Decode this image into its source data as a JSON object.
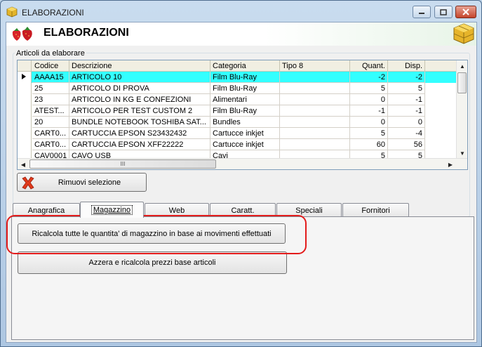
{
  "window": {
    "title": "ELABORAZIONI"
  },
  "banner": {
    "title": "ELABORAZIONI"
  },
  "group": {
    "label": "Articoli da elaborare"
  },
  "grid": {
    "columns": [
      "Codice",
      "Descrizione",
      "Categoria",
      "Tipo 8",
      "Quant.",
      "Disp."
    ],
    "rows": [
      {
        "codice": "AAAA15",
        "descrizione": "ARTICOLO 10",
        "categoria": "Film Blu-Ray",
        "tipo": "",
        "quant": "-2",
        "disp": "-2",
        "selected": true
      },
      {
        "codice": "25",
        "descrizione": "ARTICOLO DI PROVA",
        "categoria": "Film Blu-Ray",
        "tipo": "",
        "quant": "5",
        "disp": "5"
      },
      {
        "codice": "23",
        "descrizione": "ARTICOLO IN KG E CONFEZIONI",
        "categoria": "Alimentari",
        "tipo": "",
        "quant": "0",
        "disp": "-1"
      },
      {
        "codice": "ATEST...",
        "descrizione": "ARTICOLO PER TEST CUSTOM 2",
        "categoria": "Film Blu-Ray",
        "tipo": "",
        "quant": "-1",
        "disp": "-1"
      },
      {
        "codice": "20",
        "descrizione": "BUNDLE NOTEBOOK TOSHIBA SAT...",
        "categoria": "Bundles",
        "tipo": "",
        "quant": "0",
        "disp": "0"
      },
      {
        "codice": "CART0...",
        "descrizione": "CARTUCCIA EPSON S23432432",
        "categoria": "Cartucce inkjet",
        "tipo": "",
        "quant": "5",
        "disp": "-4"
      },
      {
        "codice": "CART0...",
        "descrizione": "CARTUCCIA EPSON XFF22222",
        "categoria": "Cartucce inkjet",
        "tipo": "",
        "quant": "60",
        "disp": "56"
      },
      {
        "codice": "CAV0001",
        "descrizione": "CAVO USB",
        "categoria": "Cavi",
        "tipo": "",
        "quant": "5",
        "disp": "5"
      }
    ],
    "hscroll_grip": "III"
  },
  "buttons": {
    "remove_selection": "Rimuovi selezione",
    "recalc_quantities": "Ricalcola tutte le quantita' di magazzino in base ai movimenti effettuati",
    "reset_prices": "Azzera e ricalcola prezzi base articoli"
  },
  "tabs": [
    {
      "label": "Anagrafica"
    },
    {
      "label": "Magazzino",
      "active": true
    },
    {
      "label": "Web"
    },
    {
      "label": "Caratt."
    },
    {
      "label": "Speciali"
    },
    {
      "label": "Fornitori"
    }
  ],
  "colors": {
    "selected_row": "#33ffff",
    "highlight": "#e31b1b",
    "remove_icon": "#e03a1b"
  }
}
